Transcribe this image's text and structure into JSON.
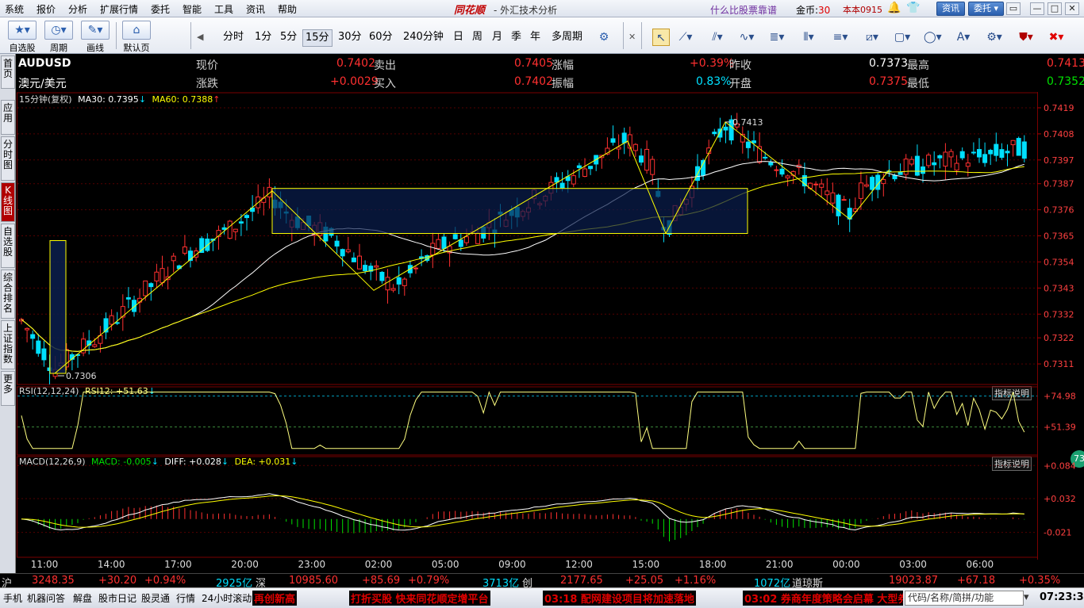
{
  "menubar": {
    "items": [
      "系统",
      "报价",
      "分析",
      "扩展行情",
      "委托",
      "智能",
      "工具",
      "资讯",
      "帮助"
    ],
    "brand": "同花顺",
    "title": "- 外汇技术分析",
    "ad": "什么比股票靠谱",
    "coins_label": "金币:",
    "coins_value": "30",
    "version": "本本0915",
    "news_btn": "资讯",
    "trade_btn": "委托"
  },
  "toolbar": {
    "buttons": [
      {
        "label": "自选股",
        "icon": "star-icon"
      },
      {
        "label": "周期",
        "icon": "clock-icon"
      },
      {
        "label": "画线",
        "icon": "pencil-icon"
      },
      {
        "label": "默认页",
        "icon": "house-icon"
      }
    ],
    "periods": [
      "分时",
      "1分",
      "5分",
      "15分",
      "30分",
      "60分",
      "240分钟",
      "日",
      "周",
      "月",
      "季",
      "年",
      "多周期"
    ],
    "active_period": "15分"
  },
  "sidebar": {
    "tabs": [
      "首页",
      "应用",
      "分时图",
      "K线图",
      "自选股",
      "综合排名",
      "上证指数",
      "更多"
    ],
    "active_tab": "K线图"
  },
  "quote": {
    "symbol": "AUDUSD",
    "name": "澳元/美元",
    "fields": [
      {
        "label": "现价",
        "value": "0.7402",
        "color": "red"
      },
      {
        "label": "卖出",
        "value": "0.7405",
        "color": "red"
      },
      {
        "label": "涨幅",
        "value": "+0.39%",
        "color": "red"
      },
      {
        "label": "昨收",
        "value": "0.7373",
        "color": "white"
      },
      {
        "label": "最高",
        "value": "0.7413",
        "color": "red"
      },
      {
        "label": "涨跌",
        "value": "+0.0029",
        "color": "red"
      },
      {
        "label": "买入",
        "value": "0.7402",
        "color": "red"
      },
      {
        "label": "振幅",
        "value": "0.83%",
        "color": "cyan"
      },
      {
        "label": "开盘",
        "value": "0.7375",
        "color": "red"
      },
      {
        "label": "最低",
        "value": "0.7352",
        "color": "green"
      }
    ]
  },
  "chart_data": [
    {
      "type": "candlestick",
      "legend": {
        "prefix": "15分钟(复权)",
        "ma30_label": "MA30: 0.7395",
        "ma60_label": "MA60: 0.7388"
      },
      "y_ticks": [
        "0.7419",
        "0.7408",
        "0.7397",
        "0.7387",
        "0.7376",
        "0.7365",
        "0.7354",
        "0.7343",
        "0.7332",
        "0.7322",
        "0.7311"
      ],
      "ylim": [
        0.7302,
        0.7421
      ],
      "high_label": "0.7413",
      "low_label": "0.7306",
      "x_ticks": [
        "11:00",
        "14:00",
        "17:00",
        "20:00",
        "23:00",
        "02:00",
        "05:00",
        "09:00",
        "12:00",
        "15:00",
        "18:00",
        "21:00",
        "00:00",
        "03:00",
        "06:00"
      ],
      "series": [
        {
          "name": "MA30",
          "color": "#ffffff"
        },
        {
          "name": "MA60",
          "color": "#ffff00"
        }
      ],
      "colors": {
        "up": "#ff3030",
        "down": "#00e0ff",
        "box": "#ffff00",
        "box_fill": "#0a1e4e"
      }
    },
    {
      "type": "line",
      "legend": {
        "prefix": "RSI(12,12,24)",
        "rsi12_label": "RSI12: +51.63"
      },
      "y_ticks": [
        "+74.98",
        "+51.39"
      ],
      "ylim": [
        30,
        82
      ],
      "hint": "指标说明",
      "series": [
        {
          "name": "RSI12",
          "color": "#ffff80"
        }
      ]
    },
    {
      "type": "bar",
      "legend": {
        "prefix": "MACD(12,26,9)",
        "macd_label": "MACD: -0.005",
        "diff_label": "DIFF: +0.028",
        "dea_label": "DEA: +0.031"
      },
      "y_ticks": [
        "+0.084",
        "+0.032",
        "-0.021"
      ],
      "ylim": [
        -0.06,
        0.098
      ],
      "hint": "指标说明",
      "badge": "73",
      "series": [
        {
          "name": "DIFF",
          "color": "#ffffff"
        },
        {
          "name": "DEA",
          "color": "#ffff00"
        }
      ]
    }
  ],
  "indexbar": {
    "sh_label": "沪",
    "sh_value": "3248.35",
    "sh_change": "+30.20",
    "sh_pct": "+0.94%",
    "sh_vol": "2925亿",
    "sz_label": "深",
    "sz_value": "10985.60",
    "sz_change": "+85.69",
    "sz_pct": "+0.79%",
    "sz_vol": "3713亿",
    "cy_label": "创",
    "cy_value": "2177.65",
    "cy_change": "+25.05",
    "cy_pct": "+1.16%",
    "cy_vol": "1072亿",
    "dj_label": "道琼斯",
    "dj_value": "19023.87",
    "dj_change": "+67.18",
    "dj_pct": "+0.35%"
  },
  "status": {
    "items": [
      "手机",
      "机器问答",
      "解盘",
      "股市日记",
      "股灵通",
      "行情",
      "24小时滚动"
    ],
    "ticker1": "再创新高",
    "ticker2": "打折买股 快来同花顺定增平台",
    "ticker3": "03:18 配网建设项目将加速落地",
    "ticker4": "03:02 券商年度策略会启幕 大型券",
    "search_placeholder": "代码/名称/简拼/功能",
    "clock": "07:23:30"
  }
}
